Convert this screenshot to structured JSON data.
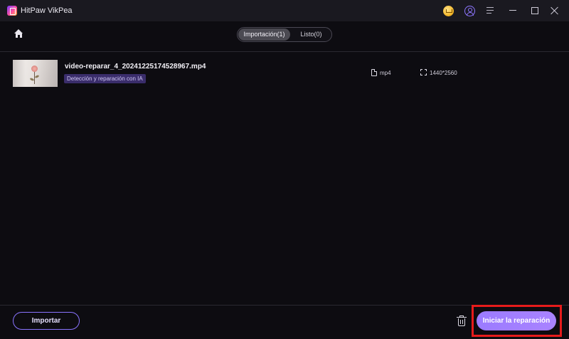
{
  "app": {
    "title": "HitPaw VikPea",
    "icons": {
      "logo": "app-logo-icon",
      "premium": "premium-crown-icon",
      "account": "account-icon",
      "menu": "menu-icon",
      "minimize": "minimize-icon",
      "maximize": "maximize-icon",
      "close": "close-icon"
    }
  },
  "nav": {
    "home_icon": "home-icon",
    "tabs": [
      {
        "label": "Importación(1)",
        "active": true
      },
      {
        "label": "Listo(0)",
        "active": false
      }
    ]
  },
  "files": [
    {
      "name": "video-reparar_4_20241225174528967.mp4",
      "badge": "Detección y reparación con IA",
      "format": "mp4",
      "resolution": "1440*2560"
    }
  ],
  "footer": {
    "import_label": "Importar",
    "start_label": "Iniciar la reparación"
  },
  "colors": {
    "background": "#0d0c11",
    "titlebar": "#1a1920",
    "accent": "#9b7bff",
    "badge_bg": "#3a2d6b",
    "highlight": "#e61b1b"
  }
}
